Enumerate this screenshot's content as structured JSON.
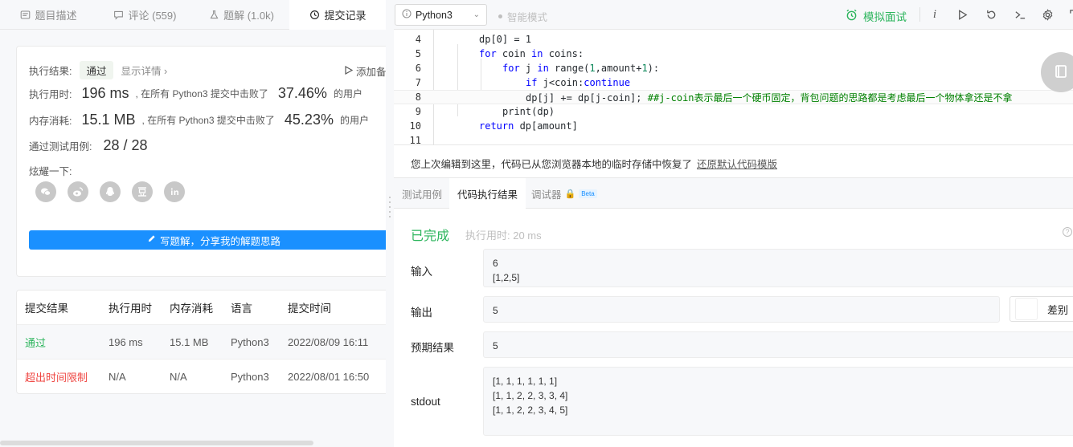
{
  "left_tabs": [
    {
      "label": "题目描述",
      "icon": "description-icon"
    },
    {
      "label": "评论 (559)",
      "icon": "comment-icon"
    },
    {
      "label": "题解 (1.0k)",
      "icon": "solution-icon"
    },
    {
      "label": "提交记录",
      "icon": "history-icon"
    }
  ],
  "result": {
    "exec_label": "执行结果:",
    "status": "通过",
    "show_detail": "显示详情 ›",
    "add_label": "添加备",
    "time_label": "执行用时:",
    "time_value": "196 ms",
    "time_mid": ", 在所有 Python3 提交中击败了",
    "time_pct": "37.46%",
    "time_tail": "的用户",
    "mem_label": "内存消耗:",
    "mem_value": "15.1 MB",
    "mem_mid": ", 在所有 Python3 提交中击败了",
    "mem_pct": "45.23%",
    "mem_tail": "的用户",
    "cases_label": "通过测试用例:",
    "cases_value": "28 / 28",
    "share_label": "炫耀一下:",
    "write_btn": "写题解，分享我的解题思路"
  },
  "social_icons": [
    "wechat-icon",
    "weibo-icon",
    "qq-icon",
    "douban-icon",
    "linkedin-icon"
  ],
  "submissions": {
    "headers": [
      "提交结果",
      "执行用时",
      "内存消耗",
      "语言",
      "提交时间"
    ],
    "rows": [
      {
        "result": "通过",
        "time": "196 ms",
        "memory": "15.1 MB",
        "lang": "Python3",
        "date": "2022/08/09 16:11"
      },
      {
        "result": "超出时间限制",
        "time": "N/A",
        "memory": "N/A",
        "lang": "Python3",
        "date": "2022/08/01 16:50"
      }
    ]
  },
  "toolbar": {
    "language": "Python3",
    "smart_mode": "智能模式",
    "mock_interview": "模拟面试"
  },
  "code_lines": [
    {
      "n": "4"
    },
    {
      "n": "5"
    },
    {
      "n": "6"
    },
    {
      "n": "7"
    },
    {
      "n": "8"
    },
    {
      "n": "9"
    },
    {
      "n": "10"
    },
    {
      "n": "11"
    }
  ],
  "code": {
    "l4": "dp[0] = 1",
    "l5a": "for",
    "l5b": " coin ",
    "l5c": "in",
    "l5d": " coins:",
    "l6a": "for",
    "l6b": " j ",
    "l6c": "in",
    "l6d": " range(",
    "l6e": "1",
    "l6f": ",amount+",
    "l6g": "1",
    "l6h": "):",
    "l7a": "if",
    "l7b": " j<coin:",
    "l7c": "continue",
    "l8a": "dp[j] += dp[j-coin]; ",
    "l8b": "##j-coin表示最后一个硬币固定，背包问题的思路都是考虑最后一个物体拿还是不拿",
    "l9": "print(dp)",
    "l10a": "return",
    "l10b": " dp[amount]"
  },
  "restore": {
    "text": "您上次编辑到这里，代码已从您浏览器本地的临时存储中恢复了",
    "link": "还原默认代码模版"
  },
  "result_tabs": {
    "testcase": "测试用例",
    "exec_result": "代码执行结果",
    "debugger": "调试器",
    "beta": "Beta"
  },
  "exec": {
    "status": "已完成",
    "runtime": "执行用时: 20 ms",
    "input_label": "输入",
    "input_value": "6\n[1,2,5]",
    "output_label": "输出",
    "output_value": "5",
    "diff_label": "差别",
    "expected_label": "预期结果",
    "expected_value": "5",
    "stdout_label": "stdout",
    "stdout_value": "[1, 1, 1, 1, 1, 1]\n[1, 1, 2, 2, 3, 3, 4]\n[1, 1, 2, 2, 3, 4, 5]"
  },
  "colors": {
    "green": "#2db55d",
    "red": "#ef4743",
    "blue": "#1a90ff"
  }
}
